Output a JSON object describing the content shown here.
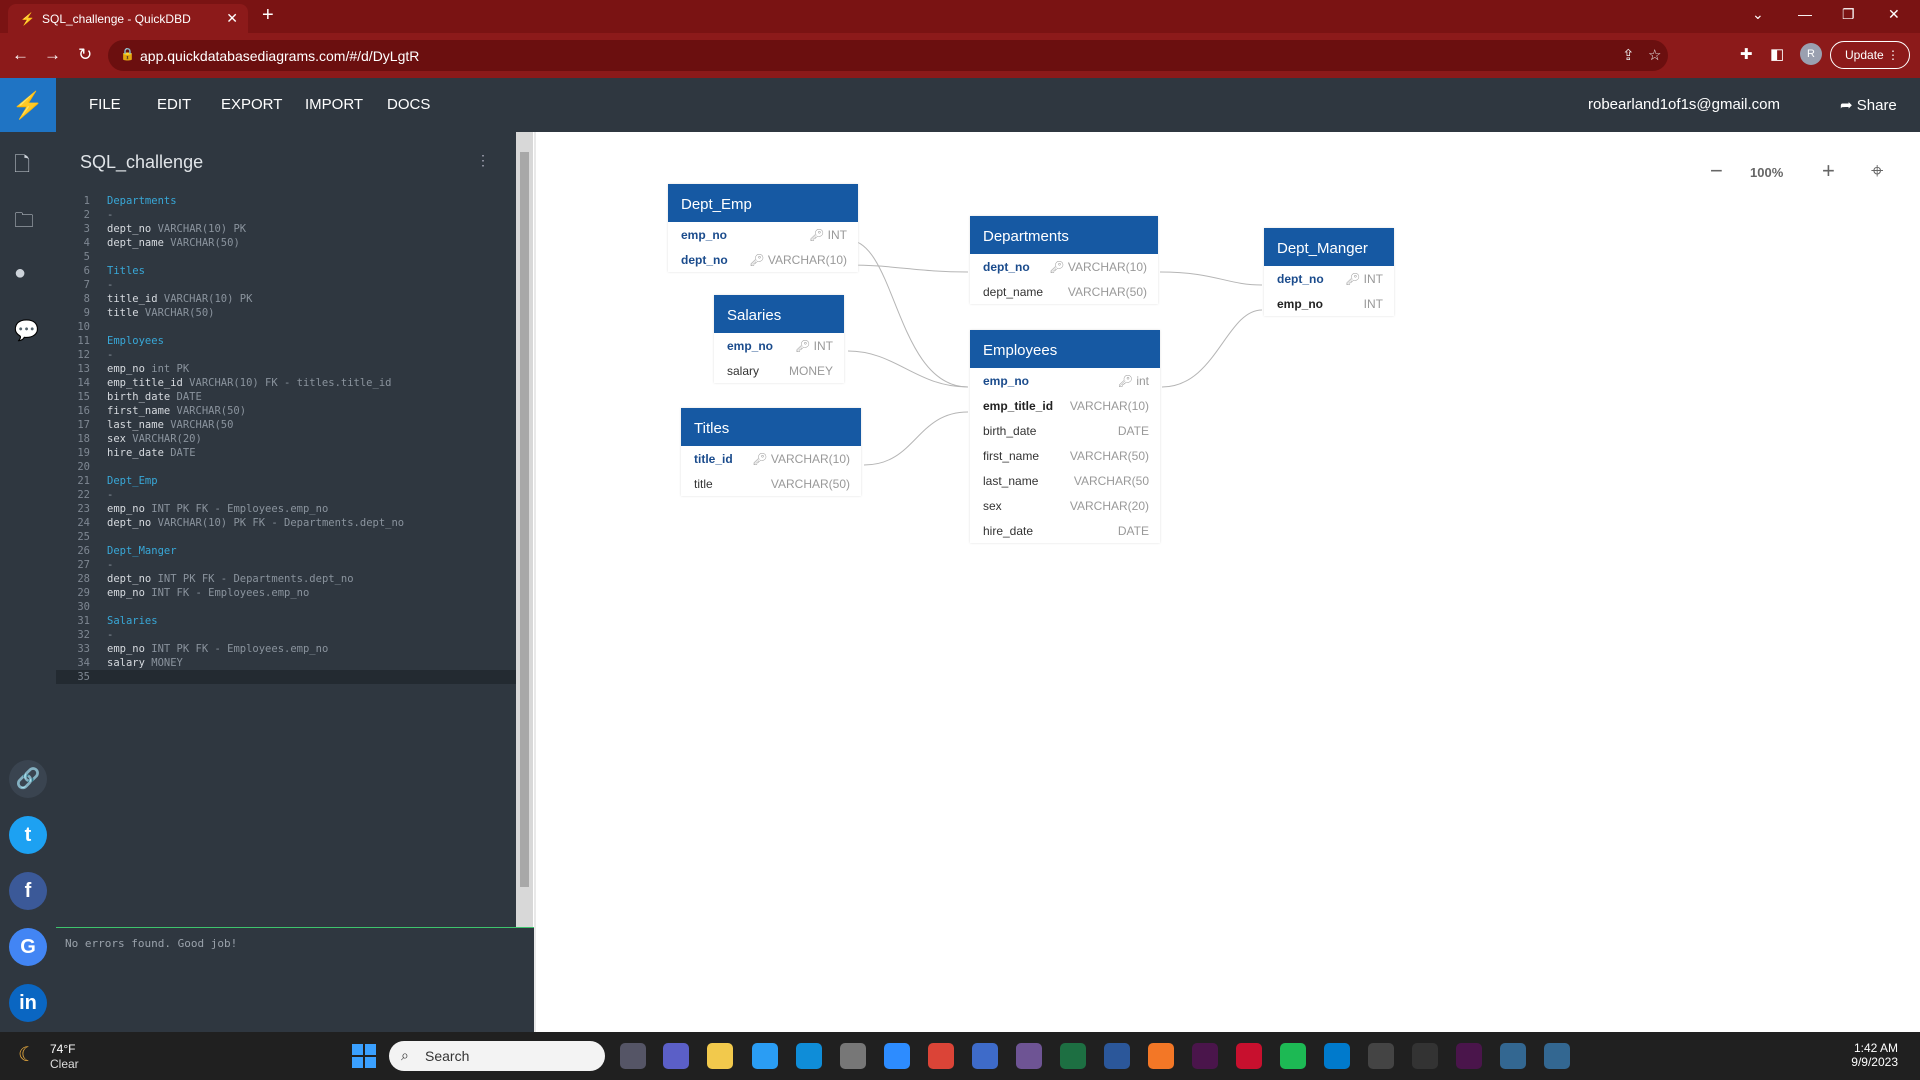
{
  "browser": {
    "tab_title": "SQL_challenge - QuickDBD",
    "url": "app.quickdatabasediagrams.com/#/d/DyLgtR",
    "update_label": "Update",
    "avatar_initial": "R"
  },
  "app": {
    "menu": [
      "FILE",
      "EDIT",
      "EXPORT",
      "IMPORT",
      "DOCS"
    ],
    "email": "robearland1of1s@gmail.com",
    "share_label": "Share"
  },
  "editor": {
    "doc_title": "SQL_challenge",
    "status": "No errors found. Good job!",
    "lines": [
      [
        "Departments",
        "",
        ""
      ],
      [
        "-",
        "",
        ""
      ],
      [
        "dept_no",
        " VARCHAR(10) PK",
        ""
      ],
      [
        "dept_name",
        " VARCHAR(50)",
        ""
      ],
      [
        "",
        "",
        ""
      ],
      [
        "Titles",
        "",
        ""
      ],
      [
        "-",
        "",
        ""
      ],
      [
        "title_id",
        " VARCHAR(10) PK",
        ""
      ],
      [
        "title",
        " VARCHAR(50)",
        ""
      ],
      [
        "",
        "",
        ""
      ],
      [
        "Employees",
        "",
        ""
      ],
      [
        "-",
        "",
        ""
      ],
      [
        "emp_no",
        " int PK",
        ""
      ],
      [
        "emp_title_id",
        " VARCHAR(10) FK - titles.title_id",
        ""
      ],
      [
        "birth_date",
        " DATE",
        ""
      ],
      [
        "first_name",
        " VARCHAR(50)",
        ""
      ],
      [
        "last_name",
        " VARCHAR(50",
        ""
      ],
      [
        "sex",
        " VARCHAR(20)",
        ""
      ],
      [
        "hire_date",
        " DATE",
        ""
      ],
      [
        "",
        "",
        ""
      ],
      [
        "Dept_Emp",
        "",
        ""
      ],
      [
        "-",
        "",
        ""
      ],
      [
        "emp_no",
        " INT PK FK - Employees.emp_no",
        ""
      ],
      [
        "dept_no",
        " VARCHAR(10) PK FK - Departments.dept_no",
        ""
      ],
      [
        "",
        "",
        ""
      ],
      [
        "Dept_Manger",
        "",
        ""
      ],
      [
        "-",
        "",
        ""
      ],
      [
        "dept_no",
        " INT PK FK - Departments.dept_no",
        ""
      ],
      [
        "emp_no",
        " INT FK - Employees.emp_no",
        ""
      ],
      [
        "",
        "",
        ""
      ],
      [
        "Salaries",
        "",
        ""
      ],
      [
        "-",
        "",
        ""
      ],
      [
        "emp_no",
        " INT PK FK - Employees.emp_no",
        ""
      ],
      [
        "salary",
        " MONEY",
        ""
      ],
      [
        "",
        "",
        ""
      ]
    ]
  },
  "canvas": {
    "zoom": "100%"
  },
  "tables": {
    "dept_emp": {
      "name": "Dept_Emp",
      "cols": [
        {
          "n": "emp_no",
          "t": "INT"
        },
        {
          "n": "dept_no",
          "t": "VARCHAR(10)"
        }
      ]
    },
    "salaries": {
      "name": "Salaries",
      "cols": [
        {
          "n": "emp_no",
          "t": "INT"
        },
        {
          "n": "salary",
          "t": "MONEY"
        }
      ]
    },
    "titles": {
      "name": "Titles",
      "cols": [
        {
          "n": "title_id",
          "t": "VARCHAR(10)"
        },
        {
          "n": "title",
          "t": "VARCHAR(50)"
        }
      ]
    },
    "departments": {
      "name": "Departments",
      "cols": [
        {
          "n": "dept_no",
          "t": "VARCHAR(10)"
        },
        {
          "n": "dept_name",
          "t": "VARCHAR(50)"
        }
      ]
    },
    "employees": {
      "name": "Employees",
      "cols": [
        {
          "n": "emp_no",
          "t": "int"
        },
        {
          "n": "emp_title_id",
          "t": "VARCHAR(10)"
        },
        {
          "n": "birth_date",
          "t": "DATE"
        },
        {
          "n": "first_name",
          "t": "VARCHAR(50)"
        },
        {
          "n": "last_name",
          "t": "VARCHAR(50"
        },
        {
          "n": "sex",
          "t": "VARCHAR(20)"
        },
        {
          "n": "hire_date",
          "t": "DATE"
        }
      ]
    },
    "dept_manger": {
      "name": "Dept_Manger",
      "cols": [
        {
          "n": "dept_no",
          "t": "INT"
        },
        {
          "n": "emp_no",
          "t": "INT"
        }
      ]
    }
  },
  "taskbar": {
    "weather_temp": "74°F",
    "weather_cond": "Clear",
    "search_label": "Search",
    "time": "1:42 AM",
    "date": "9/9/2023"
  }
}
